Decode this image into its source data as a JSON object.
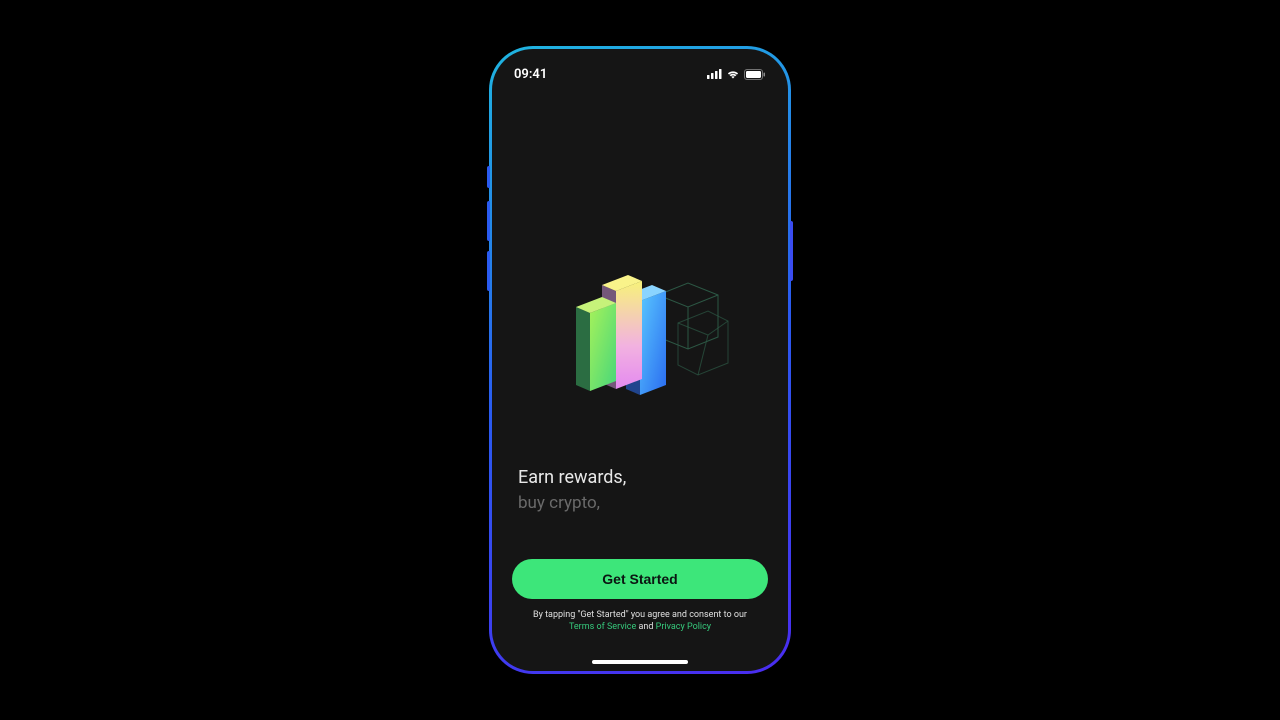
{
  "statusBar": {
    "time": "09:41"
  },
  "hero": {
    "tagline1": "Earn rewards,",
    "tagline2": "buy crypto,"
  },
  "cta": {
    "label": "Get Started"
  },
  "consent": {
    "prefix": "By tapping \"Get Started\" you agree and consent to our",
    "tosLabel": "Terms of Service",
    "joiner": " and ",
    "privacyLabel": "Privacy Policy"
  }
}
